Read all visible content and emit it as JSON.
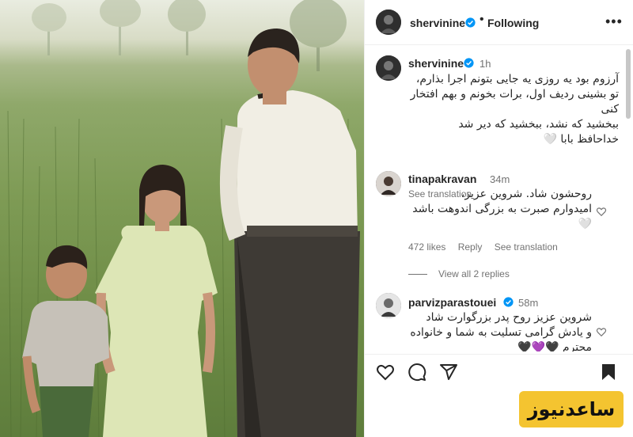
{
  "post": {
    "author": "shervinine",
    "follow_status": "Following",
    "separator": "•",
    "more_label": "•••"
  },
  "caption": {
    "author": "shervinine",
    "time": "1h",
    "text": "آرزوم بود یه روزی یه جایی بتونم اجرا بذارم،\nتو بشینی ردیف اول، برات بخونم و بهم افتخار کنی\nببخشید که نشد، ببخشید که دیر شد\nخداحافظ بابا 🤍",
    "see_translation": "See translation"
  },
  "comments": [
    {
      "author": "tinapakravan",
      "time": "34m",
      "text": "روحشون شاد. شروین عزیز،\nامیدوارم صبرت به بزرگی اندوهت باشد 🤍",
      "likes": "472 likes",
      "reply": "Reply",
      "see_translation": "See translation",
      "view_replies": "View all 2 replies"
    },
    {
      "author": "parvizparastouei",
      "time": "58m",
      "text": "شروین عزیز روح پدر بزرگوارت شاد\nو یادش گرامی تسلیت به شما و خانواده محترم 🖤💜🖤"
    }
  ],
  "icons": {
    "verified": "verified-badge-icon",
    "heart": "heart-icon",
    "comment": "comment-icon",
    "share": "share-icon",
    "save": "bookmark-icon",
    "more": "more-options-icon"
  },
  "colors": {
    "verified": "#0095f6",
    "muted": "#737373",
    "watermark_bg": "#f4c430"
  },
  "watermark": {
    "text": "ساعدنیوز"
  }
}
